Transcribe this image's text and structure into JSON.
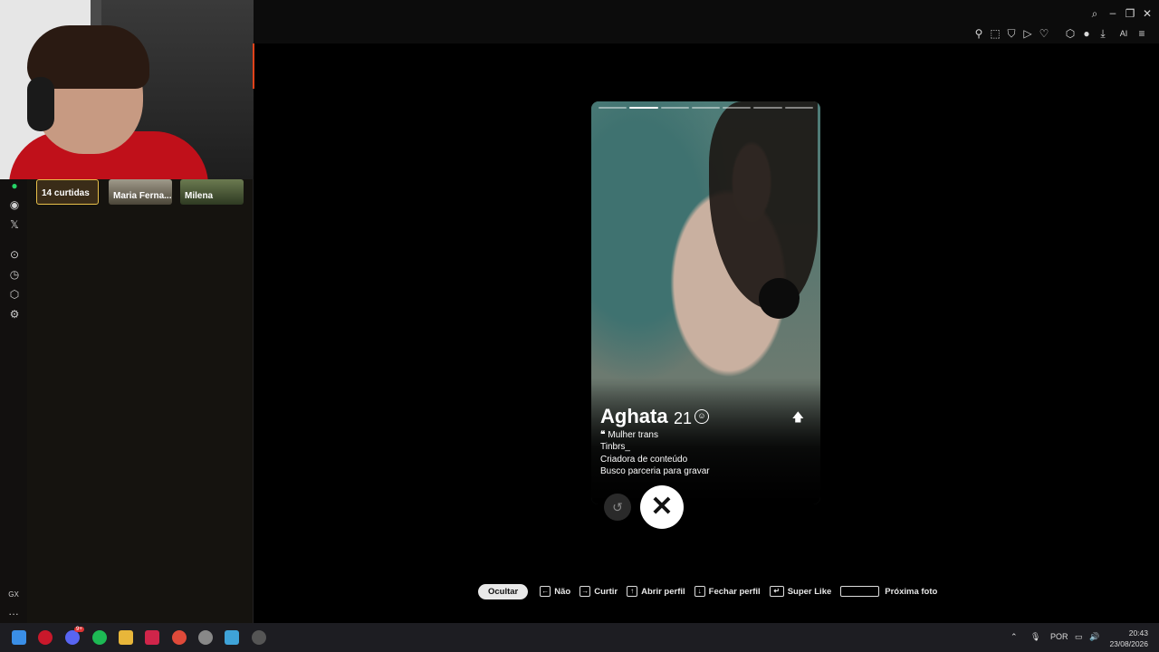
{
  "sidebar": {
    "bottom_label": "GX",
    "more": "…"
  },
  "left_panel": {
    "cards": [
      {
        "label": "14 curtidas"
      },
      {
        "label": "Maria Ferna..."
      },
      {
        "label": "Milena"
      }
    ]
  },
  "topbar": {
    "ai_label": "AI"
  },
  "profile": {
    "name": "Aghata",
    "age": "21",
    "quote_mark": "❝",
    "bio_lines": [
      "Mulher trans",
      "Tinbrs_",
      "Criadora de conteúdo",
      "Busco parceria para gravar"
    ],
    "photo_count": 7,
    "active_photo": 2
  },
  "actions": {
    "rewind_icon": "↺",
    "nope_icon": "✕"
  },
  "hotkeys": {
    "hide": "Ocultar",
    "items": [
      {
        "key": "←",
        "label": "Não"
      },
      {
        "key": "→",
        "label": "Curtir"
      },
      {
        "key": "↑",
        "label": "Abrir perfil"
      },
      {
        "key": "↓",
        "label": "Fechar perfil"
      },
      {
        "key": "↵",
        "label": "Super Like"
      },
      {
        "key": "",
        "label": "Próxima foto"
      }
    ]
  },
  "taskbar": {
    "language": "POR",
    "time": "20:43",
    "date": "23/08/2026",
    "discord_badge": "9+"
  },
  "colors": {
    "opera_red": "#e0421a",
    "likes_border": "#e8c04a",
    "whatsapp": "#25d366",
    "spotify": "#1db954"
  }
}
